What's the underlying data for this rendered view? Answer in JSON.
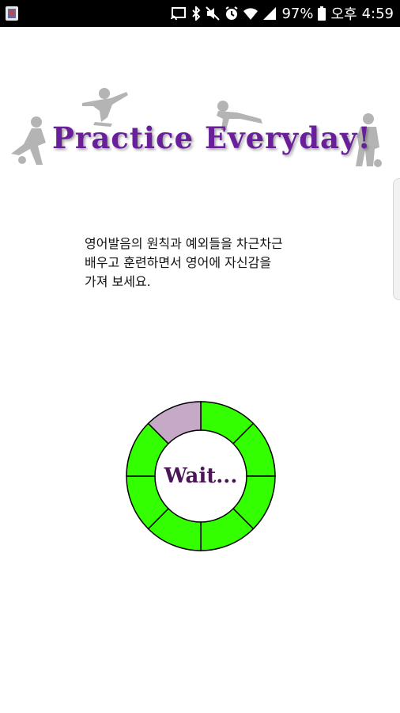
{
  "status_bar": {
    "battery_percent": "97%",
    "ampm": "오후",
    "time": "4:59",
    "icons": [
      "app-icon",
      "cast-icon",
      "bluetooth-icon",
      "mute-icon",
      "alarm-icon",
      "wifi-icon",
      "signal-icon",
      "battery-icon"
    ]
  },
  "banner": {
    "title": "Practice Everyday!"
  },
  "description": {
    "lines": [
      "영어발음의 원칙과 예외들을 차근차근",
      "배우고 훈련하면서 영어에 자신감을",
      "가져 보세요."
    ]
  },
  "loading": {
    "label": "Wait...",
    "segments_total": 8,
    "segments_done": 7,
    "done_color": "#33ff00",
    "pending_color": "#c6a9c6"
  }
}
